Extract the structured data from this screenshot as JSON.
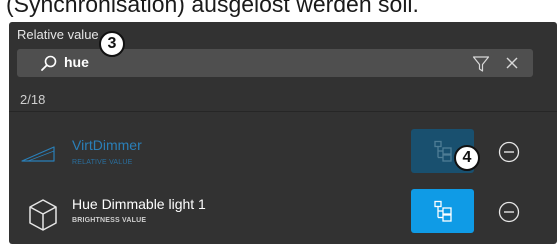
{
  "document": {
    "partial_line": "(Synchronisation) ausgelöst werden soll."
  },
  "panel": {
    "title": "Relative value",
    "search": {
      "value": "hue",
      "icon": "search-icon",
      "filter_icon": "filter-icon",
      "clear_icon": "close-icon"
    },
    "result_count": "2/18",
    "rows": [
      {
        "name": "VirtDimmer",
        "subtitle": "RELATIVE VALUE",
        "icon": "dimmer-ramp-icon",
        "state": "linked",
        "button_color": "#19506f"
      },
      {
        "name": "Hue Dimmable light 1",
        "subtitle": "BRIGHTNESS VALUE",
        "icon": "cube-device-icon",
        "state": "available",
        "button_color": "#0f9be6"
      }
    ]
  },
  "callouts": [
    "3",
    "4"
  ],
  "colors": {
    "panel_bg": "#323232",
    "search_bg": "#4f4f4f",
    "accent": "#0f9be6",
    "accent_dim": "#19506f",
    "linked_text": "#2a7fb8"
  }
}
